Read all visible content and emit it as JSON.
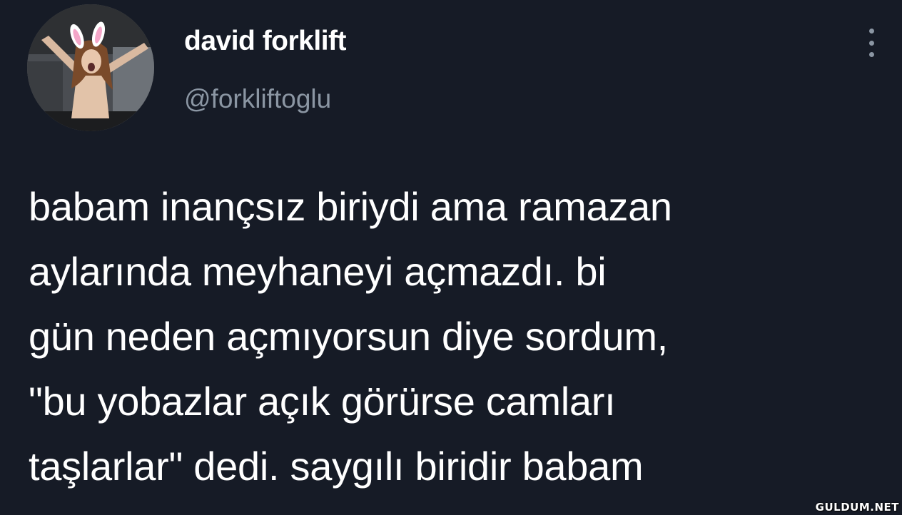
{
  "author": {
    "display_name": "david forklift",
    "handle": "@forkliftoglu",
    "avatar": "avatar-photo"
  },
  "more_menu": {
    "icon": "more-vertical-icon"
  },
  "tweet": {
    "lines": [
      "babam inançsız biriydi ama ramazan",
      "aylarında meyhaneyi açmazdı. bi",
      "gün neden açmıyorsun diye sordum,",
      "\"bu yobazlar açık görürse camları",
      "taşlarlar\" dedi. saygılı biridir babam"
    ]
  },
  "watermark": {
    "text": "GULDUM.NET"
  },
  "colors": {
    "background": "#161b26",
    "text_primary": "#ffffff",
    "text_secondary": "#8b96a3"
  }
}
